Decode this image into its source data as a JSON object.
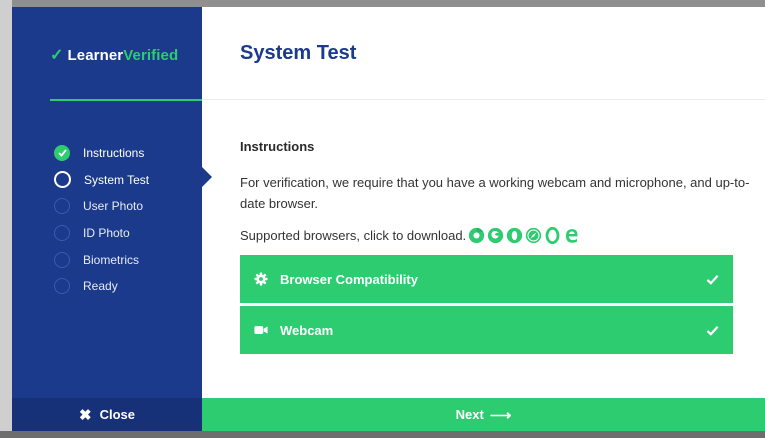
{
  "brand": {
    "name_part1": "Learner",
    "name_part2": "Verified"
  },
  "sidebar": {
    "steps": [
      {
        "label": "Instructions",
        "state": "done"
      },
      {
        "label": "System Test",
        "state": "current"
      },
      {
        "label": "User Photo",
        "state": "pending"
      },
      {
        "label": "ID Photo",
        "state": "pending"
      },
      {
        "label": "Biometrics",
        "state": "pending"
      },
      {
        "label": "Ready",
        "state": "pending"
      }
    ],
    "close_label": "Close"
  },
  "main": {
    "title": "System Test",
    "section_heading": "Instructions",
    "description": "For verification, we require that you have a working webcam and microphone, and up-to-date browser.",
    "supported_text": "Supported browsers, click to download.",
    "browsers": [
      "chrome-icon",
      "firefox-icon",
      "opera-icon",
      "safari-icon",
      "opera-icon",
      "edge-icon"
    ],
    "checks": [
      {
        "label": "Browser Compatibility",
        "icon": "gear-icon",
        "status": "passed"
      },
      {
        "label": "Webcam",
        "icon": "video-camera-icon",
        "status": "passed"
      }
    ],
    "next_label": "Next"
  },
  "colors": {
    "brand_blue": "#1b3a8c",
    "accent_green": "#2ecc71"
  }
}
